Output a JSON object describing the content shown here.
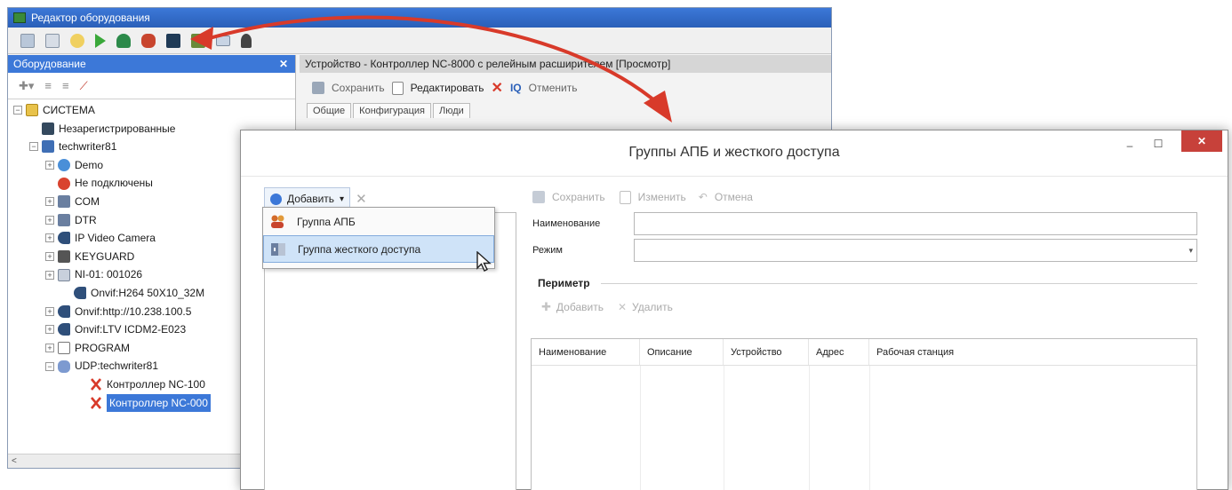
{
  "editor": {
    "title": "Редактор оборудования"
  },
  "equipment_panel": {
    "title": "Оборудование",
    "close_glyph": "✕",
    "tree": [
      {
        "label": "СИСТЕМА",
        "level": 0,
        "expander": "−",
        "icon": "folder-icon"
      },
      {
        "label": "Незарегистрированные",
        "level": 1,
        "expander": "",
        "icon": "unregistered-icon"
      },
      {
        "label": "techwriter81",
        "level": 1,
        "expander": "−",
        "icon": "computer-icon"
      },
      {
        "label": "Demo",
        "level": 2,
        "expander": "+",
        "icon": "globe-icon"
      },
      {
        "label": "Не подключены",
        "level": 2,
        "expander": "",
        "icon": "disconnected-icon"
      },
      {
        "label": "COM",
        "level": 2,
        "expander": "+",
        "icon": "port-icon"
      },
      {
        "label": "DTR",
        "level": 2,
        "expander": "+",
        "icon": "port-icon"
      },
      {
        "label": "IP Video Camera",
        "level": 2,
        "expander": "+",
        "icon": "camera-icon"
      },
      {
        "label": "KEYGUARD",
        "level": 2,
        "expander": "+",
        "icon": "keyguard-icon"
      },
      {
        "label": "NI-01: 001026",
        "level": 2,
        "expander": "+",
        "icon": "ni-icon"
      },
      {
        "label": "Onvif:H264 50X10_32M",
        "level": 3,
        "expander": "",
        "icon": "camera-icon"
      },
      {
        "label": "Onvif:http://10.238.100.5",
        "level": 2,
        "expander": "+",
        "icon": "camera-icon"
      },
      {
        "label": "Onvif:LTV ICDM2-E023",
        "level": 2,
        "expander": "+",
        "icon": "camera-icon"
      },
      {
        "label": "PROGRAM",
        "level": 2,
        "expander": "+",
        "icon": "program-icon"
      },
      {
        "label": "UDP:techwriter81",
        "level": 2,
        "expander": "−",
        "icon": "network-icon"
      },
      {
        "label": "Контроллер NC-100",
        "level": 4,
        "expander": "",
        "icon": "controller-icon"
      },
      {
        "label": "Контроллер NC-000",
        "level": 4,
        "expander": "",
        "icon": "controller-icon",
        "selected": true
      }
    ],
    "scroll_left_glyph": "<"
  },
  "device_panel": {
    "title": "Устройство - Контроллер NC-8000 с релейным расширителем [Просмотр]",
    "toolbar": {
      "save": "Сохранить",
      "edit": "Редактировать",
      "cancel": "Отменить"
    },
    "tabs": [
      "Общие",
      "Конфигурация",
      "Люди"
    ]
  },
  "dialog": {
    "title": "Группы АПБ и жесткого доступа",
    "min_glyph": "–",
    "max_glyph": "☐",
    "close_glyph": "✕",
    "add_label": "Добавить",
    "add_arrow": "▾",
    "delete_glyph": "✕",
    "dropdown_items": [
      "Группа АПБ",
      "Группа жесткого доступа"
    ],
    "right_toolbar": {
      "save": "Сохранить",
      "edit": "Изменить",
      "cancel": "Отмена"
    },
    "name_label": "Наименование",
    "name_value": "",
    "mode_label": "Режим",
    "mode_value": "",
    "mode_arrow": "▾",
    "perimeter_title": "Периметр",
    "perimeter_toolbar": {
      "add": "Добавить",
      "delete": "Удалить"
    },
    "table_columns": [
      "Наименование",
      "Описание",
      "Устройство",
      "Адрес",
      "Рабочая станция"
    ]
  },
  "colors": {
    "titlebar_blue": "#3c78d8",
    "arrow_red": "#d83a2a",
    "close_red": "#c7413a",
    "menu_highlight": "#cfe3f8"
  }
}
